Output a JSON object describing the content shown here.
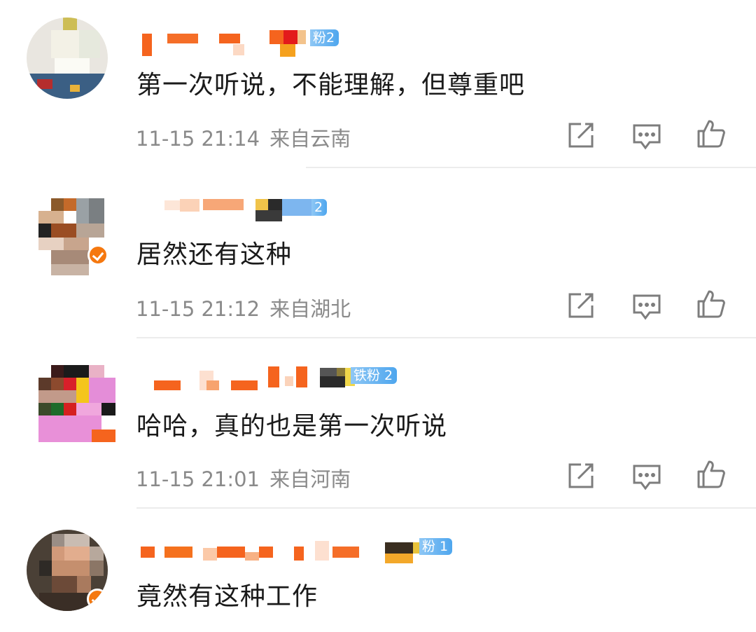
{
  "comments": [
    {
      "fan_badge": "粉2",
      "text": "第一次听说，不能理解，但尊重吧",
      "time": "11-15 21:14",
      "location": "来自云南"
    },
    {
      "fan_badge": "2",
      "text": "居然还有这种",
      "time": "11-15 21:12",
      "location": "来自湖北"
    },
    {
      "fan_badge": "铁粉 2",
      "text": "哈哈，真的也是第一次听说",
      "time": "11-15 21:01",
      "location": "来自河南"
    },
    {
      "fan_badge": "粉 1",
      "text": "竟然有这种工作"
    }
  ],
  "icons": [
    "share-icon",
    "comment-icon",
    "like-icon"
  ],
  "colors": {
    "text": "#1a1a1a",
    "meta": "#8a8a8a",
    "fan_badge": "#4ea6ee",
    "verified_badge": "#f5780f",
    "redacted_name": "#f5641e"
  }
}
